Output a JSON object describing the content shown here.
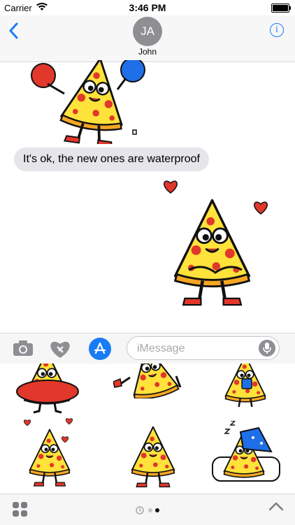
{
  "status_bar": {
    "carrier": "Carrier",
    "time": "3:46 PM",
    "battery_level": 1.0
  },
  "nav": {
    "avatar_initials": "JA",
    "contact_name": "John"
  },
  "messages": [
    {
      "from": "incoming",
      "text": "It's ok, the new ones are waterproof"
    }
  ],
  "stickers": {
    "conversation": [
      "pizza-cheerleader-sticker",
      "pizza-hugging-sticker"
    ],
    "drawer": [
      "pizza-tube-sticker",
      "pizza-running-sticker",
      "pizza-coffee-sticker",
      "pizza-hearts-sticker",
      "pizza-shy-sticker",
      "pizza-sleeping-sticker"
    ]
  },
  "input": {
    "placeholder": "iMessage"
  },
  "colors": {
    "accent": "#1a7cf5",
    "bubble_gray": "#e5e5ea",
    "pizza_yellow": "#ffe23a",
    "pepperoni": "#e2372b",
    "crust": "#f5a623",
    "sticker_blue": "#1f6fe8"
  },
  "icons": [
    "back-chevron-icon",
    "info-icon",
    "camera-icon",
    "digital-touch-heart-icon",
    "app-store-icon",
    "microphone-icon",
    "app-drawer-grid-icon",
    "chevron-up-icon"
  ],
  "page_indicator": {
    "pages": 3,
    "current": 3
  }
}
